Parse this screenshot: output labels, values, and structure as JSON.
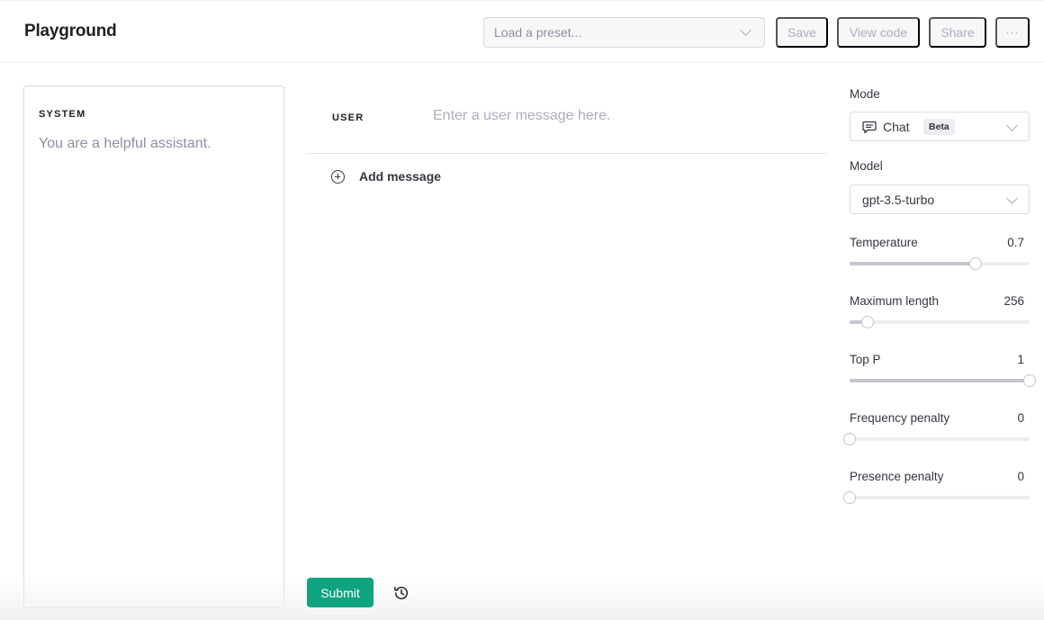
{
  "header": {
    "title": "Playground",
    "preset_placeholder": "Load a preset...",
    "buttons": {
      "save": "Save",
      "view_code": "View code",
      "share": "Share",
      "more": "···"
    }
  },
  "system": {
    "label": "SYSTEM",
    "text": "You are a helpful assistant."
  },
  "conversation": {
    "user_label": "USER",
    "user_placeholder": "Enter a user message here.",
    "user_value": "",
    "add_message_label": "Add message"
  },
  "footer": {
    "submit_label": "Submit",
    "history_icon": "history-icon"
  },
  "settings": {
    "mode": {
      "label": "Mode",
      "value": "Chat",
      "badge": "Beta",
      "icon": "chat-icon"
    },
    "model": {
      "label": "Model",
      "value": "gpt-3.5-turbo"
    },
    "params": [
      {
        "label": "Temperature",
        "value": "0.7",
        "fraction": 0.7
      },
      {
        "label": "Maximum length",
        "value": "256",
        "fraction": 0.1
      },
      {
        "label": "Top P",
        "value": "1",
        "fraction": 1.0
      },
      {
        "label": "Frequency penalty",
        "value": "0",
        "fraction": 0.0
      },
      {
        "label": "Presence penalty",
        "value": "0",
        "fraction": 0.0
      }
    ]
  },
  "colors": {
    "accent": "#10a37f",
    "slider_fill": "#c5c5d2",
    "slider_track": "#ececf1"
  }
}
